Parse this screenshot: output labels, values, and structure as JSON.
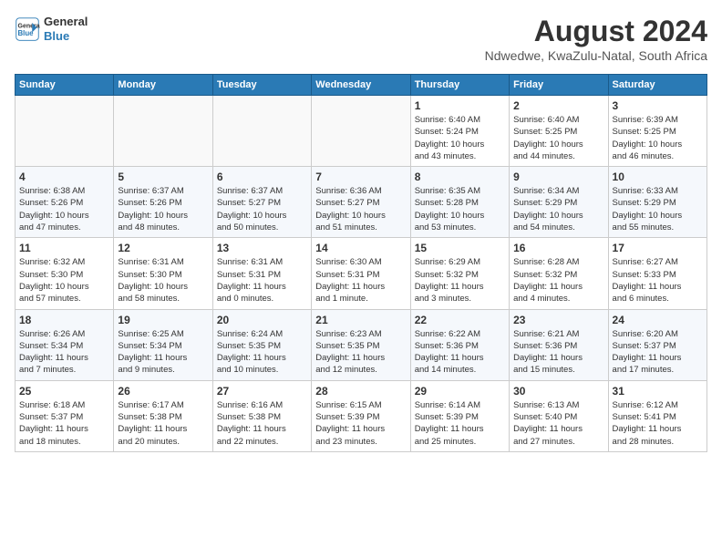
{
  "header": {
    "logo_line1": "General",
    "logo_line2": "Blue",
    "month_year": "August 2024",
    "subtitle": "Ndwedwe, KwaZulu-Natal, South Africa"
  },
  "days_of_week": [
    "Sunday",
    "Monday",
    "Tuesday",
    "Wednesday",
    "Thursday",
    "Friday",
    "Saturday"
  ],
  "weeks": [
    [
      {
        "num": "",
        "info": ""
      },
      {
        "num": "",
        "info": ""
      },
      {
        "num": "",
        "info": ""
      },
      {
        "num": "",
        "info": ""
      },
      {
        "num": "1",
        "info": "Sunrise: 6:40 AM\nSunset: 5:24 PM\nDaylight: 10 hours\nand 43 minutes."
      },
      {
        "num": "2",
        "info": "Sunrise: 6:40 AM\nSunset: 5:25 PM\nDaylight: 10 hours\nand 44 minutes."
      },
      {
        "num": "3",
        "info": "Sunrise: 6:39 AM\nSunset: 5:25 PM\nDaylight: 10 hours\nand 46 minutes."
      }
    ],
    [
      {
        "num": "4",
        "info": "Sunrise: 6:38 AM\nSunset: 5:26 PM\nDaylight: 10 hours\nand 47 minutes."
      },
      {
        "num": "5",
        "info": "Sunrise: 6:37 AM\nSunset: 5:26 PM\nDaylight: 10 hours\nand 48 minutes."
      },
      {
        "num": "6",
        "info": "Sunrise: 6:37 AM\nSunset: 5:27 PM\nDaylight: 10 hours\nand 50 minutes."
      },
      {
        "num": "7",
        "info": "Sunrise: 6:36 AM\nSunset: 5:27 PM\nDaylight: 10 hours\nand 51 minutes."
      },
      {
        "num": "8",
        "info": "Sunrise: 6:35 AM\nSunset: 5:28 PM\nDaylight: 10 hours\nand 53 minutes."
      },
      {
        "num": "9",
        "info": "Sunrise: 6:34 AM\nSunset: 5:29 PM\nDaylight: 10 hours\nand 54 minutes."
      },
      {
        "num": "10",
        "info": "Sunrise: 6:33 AM\nSunset: 5:29 PM\nDaylight: 10 hours\nand 55 minutes."
      }
    ],
    [
      {
        "num": "11",
        "info": "Sunrise: 6:32 AM\nSunset: 5:30 PM\nDaylight: 10 hours\nand 57 minutes."
      },
      {
        "num": "12",
        "info": "Sunrise: 6:31 AM\nSunset: 5:30 PM\nDaylight: 10 hours\nand 58 minutes."
      },
      {
        "num": "13",
        "info": "Sunrise: 6:31 AM\nSunset: 5:31 PM\nDaylight: 11 hours\nand 0 minutes."
      },
      {
        "num": "14",
        "info": "Sunrise: 6:30 AM\nSunset: 5:31 PM\nDaylight: 11 hours\nand 1 minute."
      },
      {
        "num": "15",
        "info": "Sunrise: 6:29 AM\nSunset: 5:32 PM\nDaylight: 11 hours\nand 3 minutes."
      },
      {
        "num": "16",
        "info": "Sunrise: 6:28 AM\nSunset: 5:32 PM\nDaylight: 11 hours\nand 4 minutes."
      },
      {
        "num": "17",
        "info": "Sunrise: 6:27 AM\nSunset: 5:33 PM\nDaylight: 11 hours\nand 6 minutes."
      }
    ],
    [
      {
        "num": "18",
        "info": "Sunrise: 6:26 AM\nSunset: 5:34 PM\nDaylight: 11 hours\nand 7 minutes."
      },
      {
        "num": "19",
        "info": "Sunrise: 6:25 AM\nSunset: 5:34 PM\nDaylight: 11 hours\nand 9 minutes."
      },
      {
        "num": "20",
        "info": "Sunrise: 6:24 AM\nSunset: 5:35 PM\nDaylight: 11 hours\nand 10 minutes."
      },
      {
        "num": "21",
        "info": "Sunrise: 6:23 AM\nSunset: 5:35 PM\nDaylight: 11 hours\nand 12 minutes."
      },
      {
        "num": "22",
        "info": "Sunrise: 6:22 AM\nSunset: 5:36 PM\nDaylight: 11 hours\nand 14 minutes."
      },
      {
        "num": "23",
        "info": "Sunrise: 6:21 AM\nSunset: 5:36 PM\nDaylight: 11 hours\nand 15 minutes."
      },
      {
        "num": "24",
        "info": "Sunrise: 6:20 AM\nSunset: 5:37 PM\nDaylight: 11 hours\nand 17 minutes."
      }
    ],
    [
      {
        "num": "25",
        "info": "Sunrise: 6:18 AM\nSunset: 5:37 PM\nDaylight: 11 hours\nand 18 minutes."
      },
      {
        "num": "26",
        "info": "Sunrise: 6:17 AM\nSunset: 5:38 PM\nDaylight: 11 hours\nand 20 minutes."
      },
      {
        "num": "27",
        "info": "Sunrise: 6:16 AM\nSunset: 5:38 PM\nDaylight: 11 hours\nand 22 minutes."
      },
      {
        "num": "28",
        "info": "Sunrise: 6:15 AM\nSunset: 5:39 PM\nDaylight: 11 hours\nand 23 minutes."
      },
      {
        "num": "29",
        "info": "Sunrise: 6:14 AM\nSunset: 5:39 PM\nDaylight: 11 hours\nand 25 minutes."
      },
      {
        "num": "30",
        "info": "Sunrise: 6:13 AM\nSunset: 5:40 PM\nDaylight: 11 hours\nand 27 minutes."
      },
      {
        "num": "31",
        "info": "Sunrise: 6:12 AM\nSunset: 5:41 PM\nDaylight: 11 hours\nand 28 minutes."
      }
    ]
  ]
}
